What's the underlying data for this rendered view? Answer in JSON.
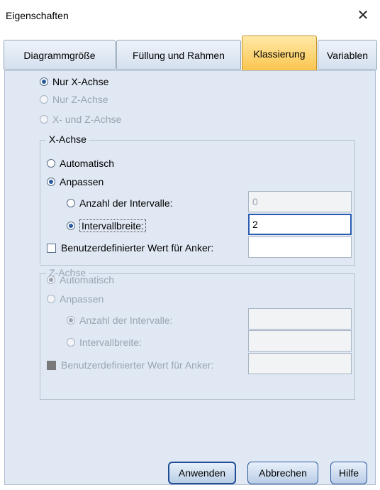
{
  "window": {
    "title": "Eigenschaften",
    "close_glyph": "✕"
  },
  "tabs": [
    {
      "label": "Diagrammgröße"
    },
    {
      "label": "Füllung und Rahmen"
    },
    {
      "label": "Klassierung"
    },
    {
      "label": "Variablen"
    }
  ],
  "active_tab": "Klassierung",
  "axis_choice": {
    "nur_x": "Nur X-Achse",
    "nur_z": "Nur Z-Achse",
    "x_und_z": "X- und Z-Achse",
    "selected": "nur_x"
  },
  "x_axis": {
    "legend": "X-Achse",
    "automatisch": "Automatisch",
    "anpassen": "Anpassen",
    "anzahl_label": "Anzahl der Intervalle:",
    "anzahl_value": "0",
    "intervallbreite_label": "Intervallbreite:",
    "intervallbreite_value": "2",
    "anker_label": "Benutzerdefinierter Wert für Anker:",
    "anker_value": ""
  },
  "z_axis": {
    "legend": "Z-Achse",
    "automatisch": "Automatisch",
    "anpassen": "Anpassen",
    "anzahl_label": "Anzahl der Intervalle:",
    "anzahl_value": "",
    "intervallbreite_label": "Intervallbreite:",
    "intervallbreite_value": "",
    "anker_label": "Benutzerdefinierter Wert für Anker:",
    "anker_value": ""
  },
  "buttons": {
    "apply": "Anwenden",
    "cancel": "Abbrechen",
    "help": "Hilfe"
  },
  "colors": {
    "active_tab": "#fbc54f",
    "panel": "#dfe8f3",
    "focus_border": "#2a5db0"
  }
}
